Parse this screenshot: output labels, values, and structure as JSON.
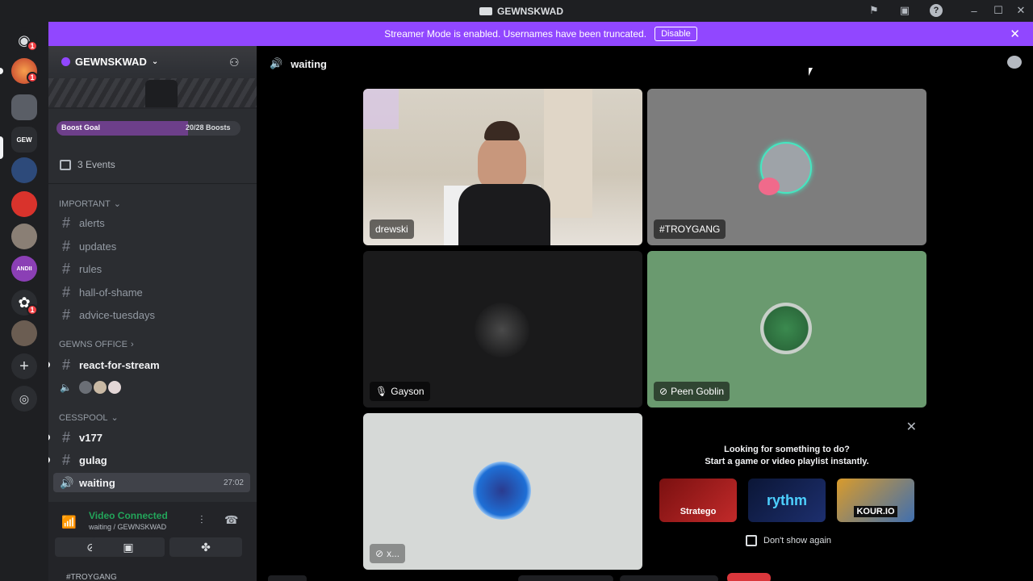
{
  "window": {
    "title": "GEWNSKWAD"
  },
  "rail": {
    "badge1": "1",
    "badge2": "1",
    "badge3": "1"
  },
  "banner": {
    "message": "Streamer Mode is enabled. Usernames have been truncated.",
    "disable_label": "Disable"
  },
  "server": {
    "name": "GEWNSKWAD",
    "boost_label": "Boost Goal",
    "boost_count": "20/28 Boosts",
    "boost_progress": 0.714,
    "events_label": "3 Events"
  },
  "categories": {
    "important": "IMPORTANT",
    "office": "GEWNS OFFICE",
    "cesspool": "CESSPOOL"
  },
  "channels": {
    "alerts": "alerts",
    "updates": "updates",
    "rules": "rules",
    "hall": "hall-of-shame",
    "advice": "advice-tuesdays",
    "react": "react-for-stream",
    "v177": "v177",
    "gulag": "gulag",
    "waiting": "waiting",
    "waiting_time": "27:02"
  },
  "voice": {
    "status": "Video Connected",
    "location": "waiting / GEWNSKWAD",
    "below_user": "#TROYGANG"
  },
  "main": {
    "channel": "waiting",
    "tiles": {
      "drewski": "drewski",
      "troygang": "#TROYGANG",
      "gayson": "Gayson",
      "peen": "Peen Goblin",
      "x": "x..."
    }
  },
  "suggest": {
    "line1": "Looking for something to do?",
    "line2": "Start a game or video playlist instantly.",
    "game1": "Stratego",
    "game2": "rythm",
    "game3": "KOUR.IO",
    "dont_show": "Don't show again"
  },
  "colors": {
    "banner": "#9147ff",
    "connected": "#23a55a",
    "badge": "#f23f43",
    "peen_bg": "#6a9a6f"
  }
}
